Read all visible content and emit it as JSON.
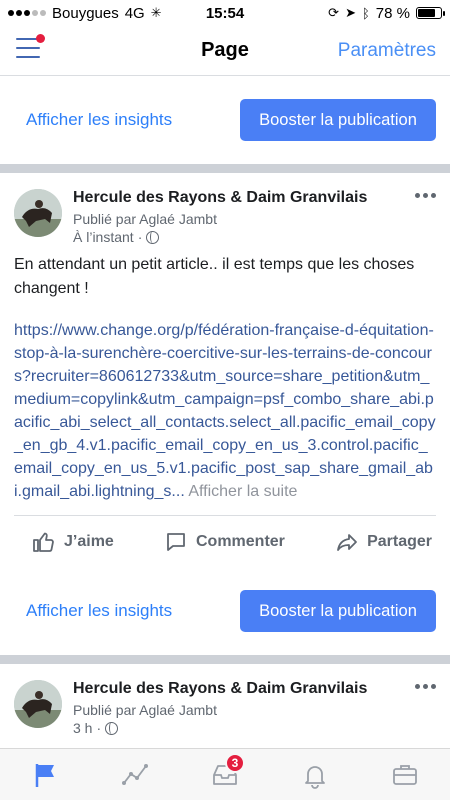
{
  "status_bar": {
    "carrier": "Bouygues",
    "network": "4G",
    "time": "15:54",
    "battery_percent": "78 %",
    "battery_level": 0.78
  },
  "nav": {
    "title": "Page",
    "right_label": "Paramètres"
  },
  "actions": {
    "insights_label": "Afficher les insights",
    "boost_label": "Booster la publication"
  },
  "posts": [
    {
      "author": "Hercule des Rayons & Daim Granvilais",
      "byline": "Publié par Aglaé Jambt",
      "time": "À l’instant",
      "text": "En attendant un petit article.. il est temps que les choses changent !",
      "link": "https://www.change.org/p/fédération-française-d-équitation-stop-à-la-surenchère-coercitive-sur-les-terrains-de-concours?recruiter=860612733&utm_source=share_petition&utm_medium=copylink&utm_campaign=psf_combo_share_abi.pacific_abi_select_all_contacts.select_all.pacific_email_copy_en_gb_4.v1.pacific_email_copy_en_us_3.control.pacific_email_copy_en_us_5.v1.pacific_post_sap_share_gmail_abi.gmail_abi.lightning_s...",
      "see_more": "Afficher la suite",
      "like_label": "J’aime",
      "comment_label": "Commenter",
      "share_label": "Partager"
    },
    {
      "author": "Hercule des Rayons & Daim Granvilais",
      "byline": "Publié par Aglaé Jambt",
      "time": "3 h"
    }
  ],
  "tab_bar": {
    "tabs": [
      "flag-icon",
      "insights-icon",
      "inbox-icon",
      "bell-icon",
      "briefcase-icon"
    ],
    "inbox_badge": "3",
    "active_color": "#4a7ff5",
    "inactive_color": "#9aa0a8"
  }
}
